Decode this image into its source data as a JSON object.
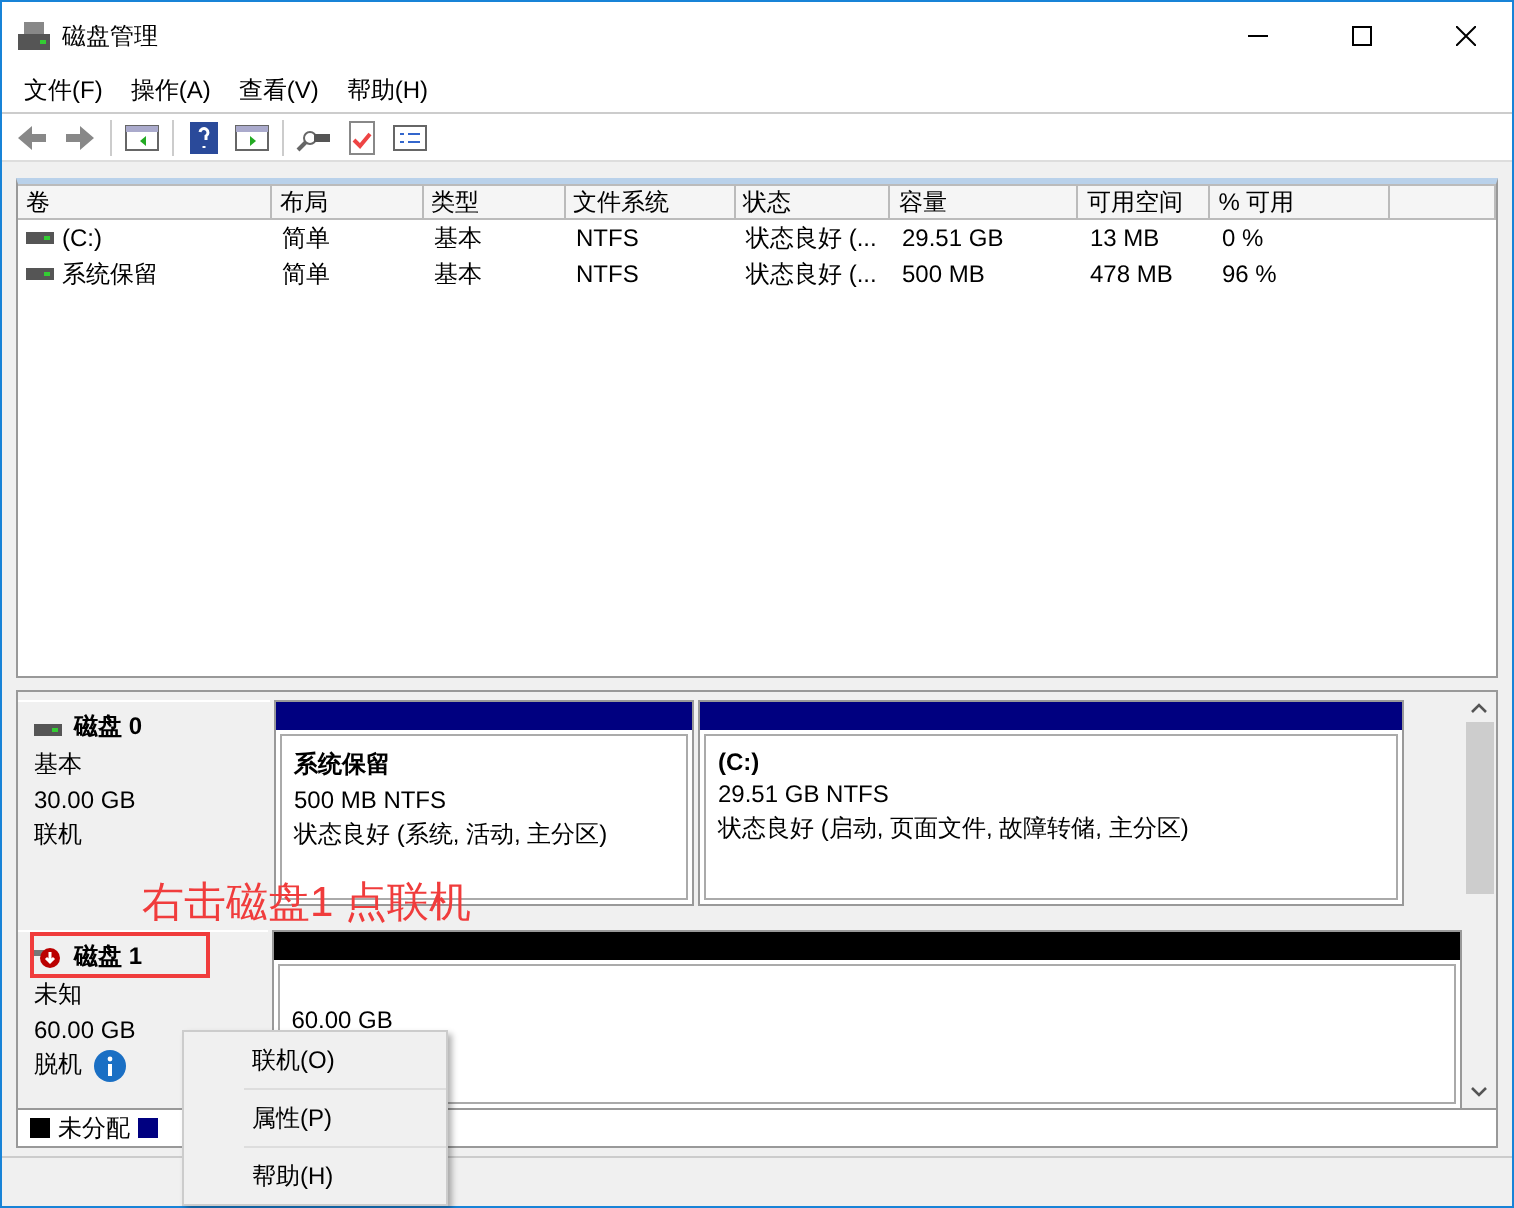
{
  "window": {
    "title": "磁盘管理"
  },
  "menu": [
    "文件(F)",
    "操作(A)",
    "查看(V)",
    "帮助(H)"
  ],
  "table": {
    "columns": [
      "卷",
      "布局",
      "类型",
      "文件系统",
      "状态",
      "容量",
      "可用空间",
      "% 可用"
    ],
    "rows": [
      [
        "(C:)",
        "简单",
        "基本",
        "NTFS",
        "状态良好 (...",
        "29.51 GB",
        "13 MB",
        "0 %"
      ],
      [
        "系统保留",
        "简单",
        "基本",
        "NTFS",
        "状态良好 (...",
        "500 MB",
        "478 MB",
        "96 %"
      ]
    ]
  },
  "disks": [
    {
      "name": "磁盘 0",
      "offline": false,
      "lines": [
        "基本",
        "30.00 GB",
        "联机"
      ],
      "info": false,
      "partitions": [
        {
          "name": "系统保留",
          "size": "500 MB NTFS",
          "status": "状态良好 (系统, 活动, 主分区)",
          "color": "#000080"
        },
        {
          "name": "(C:)",
          "size": "29.51 GB NTFS",
          "status": "状态良好 (启动, 页面文件, 故障转储, 主分区)",
          "color": "#000080"
        }
      ]
    },
    {
      "name": "磁盘 1",
      "offline": true,
      "lines": [
        "未知",
        "60.00 GB",
        "脱机"
      ],
      "info": true,
      "partitions": [
        {
          "size": "60.00 GB",
          "color": "#000000"
        }
      ]
    }
  ],
  "legend": [
    {
      "label": "未分配",
      "color": "#000000"
    },
    {
      "color": "#000080"
    }
  ],
  "annotation": "右击磁盘1 点联机",
  "context_menu": [
    "联机(O)",
    "属性(P)",
    "帮助(H)"
  ]
}
